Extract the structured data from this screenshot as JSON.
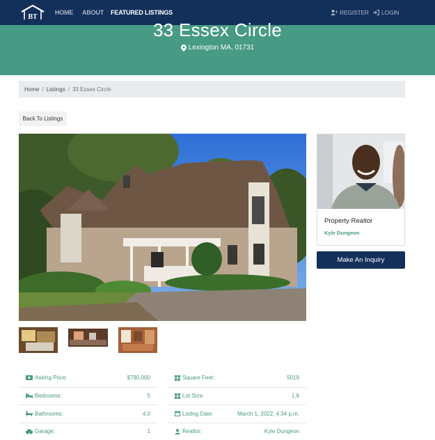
{
  "nav": {
    "brand": "BT",
    "links": [
      {
        "label": "HOME"
      },
      {
        "label": "ABOUT"
      },
      {
        "label": "FEATURED LISTINGS"
      }
    ],
    "register": "REGISTER",
    "login": "LOGIN"
  },
  "listing": {
    "title": "33 Essex Circle",
    "location": "Lexington MA, 01731"
  },
  "breadcrumb": {
    "home": "Home",
    "listings": "Listings",
    "current": "33 Essex Circle"
  },
  "back_button": "Back To Listings",
  "realtor": {
    "title": "Property Realtor",
    "name": "Kyle Dungeon"
  },
  "inquiry_button": "Make An Inquiry",
  "details_left": [
    {
      "icon": "money-icon",
      "label": "Asking Price:",
      "value": "$780,000"
    },
    {
      "icon": "bed-icon",
      "label": "Bedrooms:",
      "value": "5"
    },
    {
      "icon": "bath-icon",
      "label": "Bathrooms:",
      "value": "4.0"
    },
    {
      "icon": "car-icon",
      "label": "Garage:",
      "value": "1"
    }
  ],
  "details_right": [
    {
      "icon": "square-feet-icon",
      "label": "Square Feet:",
      "value": "5019"
    },
    {
      "icon": "lot-size-icon",
      "label": "Lot Size:",
      "value": "1.8"
    },
    {
      "icon": "calendar-icon",
      "label": "Listing Date:",
      "value": "March 1, 2022, 4:34 p.m."
    },
    {
      "icon": "realtor-icon",
      "label": "Realtor:",
      "value": "Kyle Dungeon"
    }
  ],
  "colors": {
    "navbar": "#12305a",
    "hero": "#479a83",
    "accent": "#479a83"
  }
}
